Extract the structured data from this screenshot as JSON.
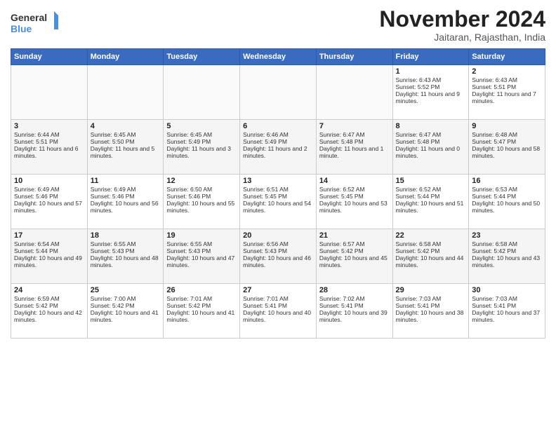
{
  "header": {
    "logo_general": "General",
    "logo_blue": "Blue",
    "month_title": "November 2024",
    "subtitle": "Jaitaran, Rajasthan, India"
  },
  "calendar": {
    "days_of_week": [
      "Sunday",
      "Monday",
      "Tuesday",
      "Wednesday",
      "Thursday",
      "Friday",
      "Saturday"
    ],
    "weeks": [
      [
        {
          "day": "",
          "content": ""
        },
        {
          "day": "",
          "content": ""
        },
        {
          "day": "",
          "content": ""
        },
        {
          "day": "",
          "content": ""
        },
        {
          "day": "",
          "content": ""
        },
        {
          "day": "1",
          "content": "Sunrise: 6:43 AM\nSunset: 5:52 PM\nDaylight: 11 hours and 9 minutes."
        },
        {
          "day": "2",
          "content": "Sunrise: 6:43 AM\nSunset: 5:51 PM\nDaylight: 11 hours and 7 minutes."
        }
      ],
      [
        {
          "day": "3",
          "content": "Sunrise: 6:44 AM\nSunset: 5:51 PM\nDaylight: 11 hours and 6 minutes."
        },
        {
          "day": "4",
          "content": "Sunrise: 6:45 AM\nSunset: 5:50 PM\nDaylight: 11 hours and 5 minutes."
        },
        {
          "day": "5",
          "content": "Sunrise: 6:45 AM\nSunset: 5:49 PM\nDaylight: 11 hours and 3 minutes."
        },
        {
          "day": "6",
          "content": "Sunrise: 6:46 AM\nSunset: 5:49 PM\nDaylight: 11 hours and 2 minutes."
        },
        {
          "day": "7",
          "content": "Sunrise: 6:47 AM\nSunset: 5:48 PM\nDaylight: 11 hours and 1 minute."
        },
        {
          "day": "8",
          "content": "Sunrise: 6:47 AM\nSunset: 5:48 PM\nDaylight: 11 hours and 0 minutes."
        },
        {
          "day": "9",
          "content": "Sunrise: 6:48 AM\nSunset: 5:47 PM\nDaylight: 10 hours and 58 minutes."
        }
      ],
      [
        {
          "day": "10",
          "content": "Sunrise: 6:49 AM\nSunset: 5:46 PM\nDaylight: 10 hours and 57 minutes."
        },
        {
          "day": "11",
          "content": "Sunrise: 6:49 AM\nSunset: 5:46 PM\nDaylight: 10 hours and 56 minutes."
        },
        {
          "day": "12",
          "content": "Sunrise: 6:50 AM\nSunset: 5:46 PM\nDaylight: 10 hours and 55 minutes."
        },
        {
          "day": "13",
          "content": "Sunrise: 6:51 AM\nSunset: 5:45 PM\nDaylight: 10 hours and 54 minutes."
        },
        {
          "day": "14",
          "content": "Sunrise: 6:52 AM\nSunset: 5:45 PM\nDaylight: 10 hours and 53 minutes."
        },
        {
          "day": "15",
          "content": "Sunrise: 6:52 AM\nSunset: 5:44 PM\nDaylight: 10 hours and 51 minutes."
        },
        {
          "day": "16",
          "content": "Sunrise: 6:53 AM\nSunset: 5:44 PM\nDaylight: 10 hours and 50 minutes."
        }
      ],
      [
        {
          "day": "17",
          "content": "Sunrise: 6:54 AM\nSunset: 5:44 PM\nDaylight: 10 hours and 49 minutes."
        },
        {
          "day": "18",
          "content": "Sunrise: 6:55 AM\nSunset: 5:43 PM\nDaylight: 10 hours and 48 minutes."
        },
        {
          "day": "19",
          "content": "Sunrise: 6:55 AM\nSunset: 5:43 PM\nDaylight: 10 hours and 47 minutes."
        },
        {
          "day": "20",
          "content": "Sunrise: 6:56 AM\nSunset: 5:43 PM\nDaylight: 10 hours and 46 minutes."
        },
        {
          "day": "21",
          "content": "Sunrise: 6:57 AM\nSunset: 5:42 PM\nDaylight: 10 hours and 45 minutes."
        },
        {
          "day": "22",
          "content": "Sunrise: 6:58 AM\nSunset: 5:42 PM\nDaylight: 10 hours and 44 minutes."
        },
        {
          "day": "23",
          "content": "Sunrise: 6:58 AM\nSunset: 5:42 PM\nDaylight: 10 hours and 43 minutes."
        }
      ],
      [
        {
          "day": "24",
          "content": "Sunrise: 6:59 AM\nSunset: 5:42 PM\nDaylight: 10 hours and 42 minutes."
        },
        {
          "day": "25",
          "content": "Sunrise: 7:00 AM\nSunset: 5:42 PM\nDaylight: 10 hours and 41 minutes."
        },
        {
          "day": "26",
          "content": "Sunrise: 7:01 AM\nSunset: 5:42 PM\nDaylight: 10 hours and 41 minutes."
        },
        {
          "day": "27",
          "content": "Sunrise: 7:01 AM\nSunset: 5:41 PM\nDaylight: 10 hours and 40 minutes."
        },
        {
          "day": "28",
          "content": "Sunrise: 7:02 AM\nSunset: 5:41 PM\nDaylight: 10 hours and 39 minutes."
        },
        {
          "day": "29",
          "content": "Sunrise: 7:03 AM\nSunset: 5:41 PM\nDaylight: 10 hours and 38 minutes."
        },
        {
          "day": "30",
          "content": "Sunrise: 7:03 AM\nSunset: 5:41 PM\nDaylight: 10 hours and 37 minutes."
        }
      ]
    ]
  }
}
